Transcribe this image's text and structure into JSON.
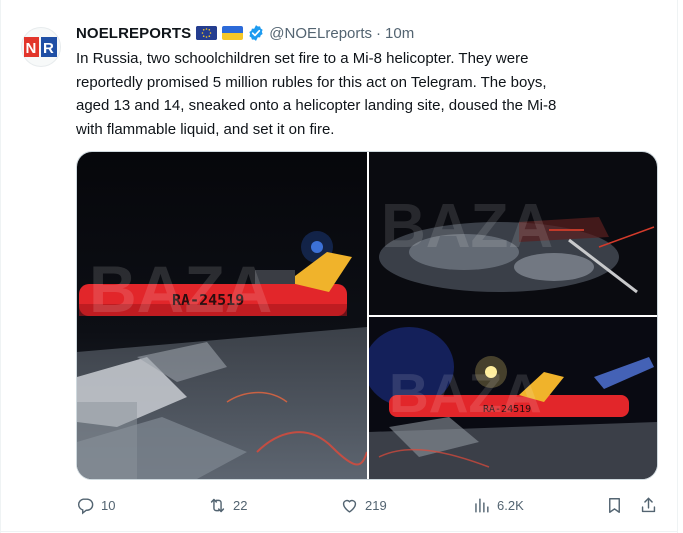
{
  "author": {
    "display_name": "NOELREPORTS",
    "handle": "@NOELreports",
    "separator": "·",
    "time": "10m",
    "avatar_text": "NR",
    "flags": [
      "eu-flag-icon",
      "ukraine-flag-icon"
    ],
    "verified_icon": "verified-badge-icon"
  },
  "tweet": {
    "text": "In Russia, two schoolchildren set fire to a Mi-8 helicopter. They were\nreportedly promised 5 million rubles for this act on Telegram. The boys,\naged 13 and 14, sneaked onto a helicopter landing site, doused the Mi-8\nwith flammable liquid, and set it on fire."
  },
  "media": {
    "watermark": "BAZA",
    "registration": "RA-24519",
    "images": [
      "main-helicopter-photo",
      "burnt-wreckage-photo",
      "helicopter-night-photo"
    ]
  },
  "actions": {
    "reply_count": "10",
    "retweet_count": "22",
    "like_count": "219",
    "views_count": "6.2K"
  },
  "colors": {
    "text": "#0f1419",
    "secondary": "#536471",
    "verified": "#1d9bf0",
    "border": "#cfd9de",
    "avatar_red": "#e2352b",
    "avatar_blue": "#1f4fa5"
  }
}
